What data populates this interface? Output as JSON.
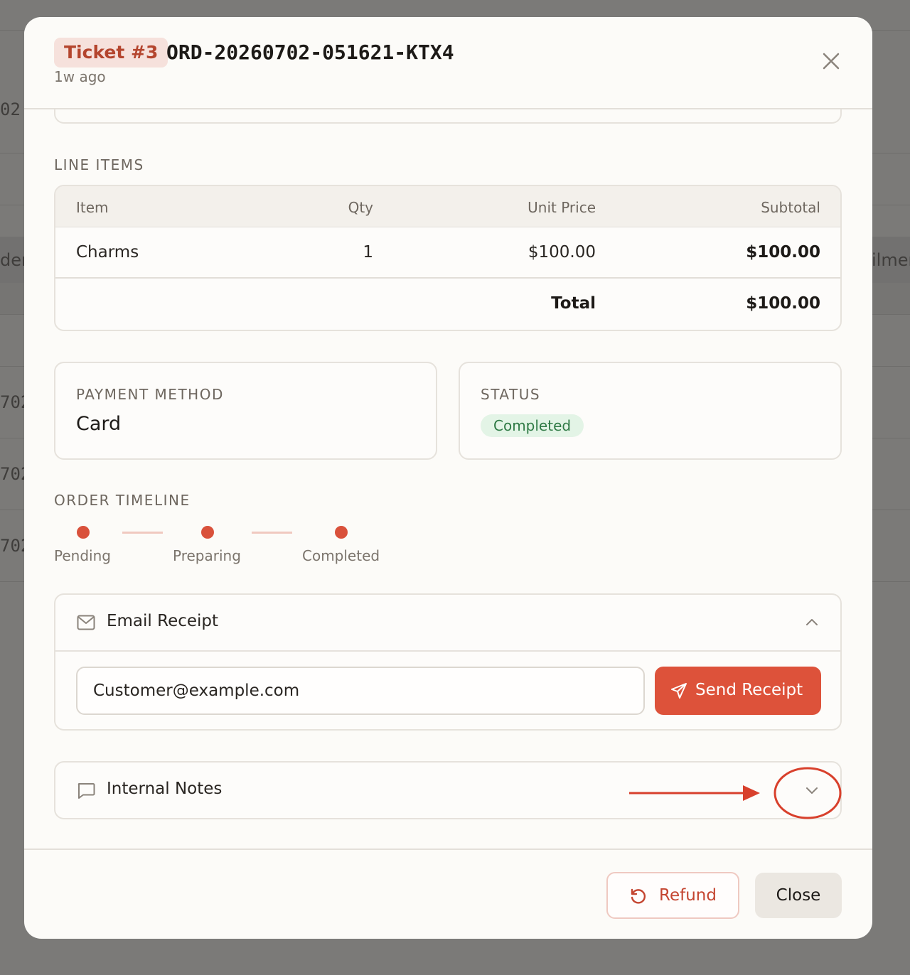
{
  "background": {
    "fragments": [
      "02",
      "der",
      "702",
      "702",
      "702",
      "ilmer"
    ]
  },
  "modal": {
    "ticket_badge": "Ticket #3",
    "order_id": "ORD-20260702-051621-KTX4",
    "time_ago": "1w ago",
    "line_items": {
      "section_label": "LINE ITEMS",
      "columns": [
        "Item",
        "Qty",
        "Unit Price",
        "Subtotal"
      ],
      "rows": [
        {
          "item": "Charms",
          "qty": "1",
          "unit_price": "$100.00",
          "subtotal": "$100.00"
        }
      ],
      "total_label": "Total",
      "total_value": "$100.00"
    },
    "payment": {
      "label": "PAYMENT METHOD",
      "value": "Card"
    },
    "status": {
      "label": "STATUS",
      "value": "Completed",
      "color": "#2f7a45"
    },
    "timeline": {
      "section_label": "ORDER TIMELINE",
      "steps": [
        "Pending",
        "Preparing",
        "Completed"
      ]
    },
    "email_receipt": {
      "title": "Email Receipt",
      "expanded": true,
      "email_value": "Customer@example.com",
      "send_label": "Send Receipt"
    },
    "internal_notes": {
      "title": "Internal Notes",
      "expanded": false
    },
    "footer": {
      "refund_label": "Refund",
      "close_label": "Close"
    }
  },
  "colors": {
    "accent": "#dd523a",
    "badge_bg": "#f6e1dc",
    "status_bg": "#e3f4e6",
    "annotation": "#d8402c"
  }
}
